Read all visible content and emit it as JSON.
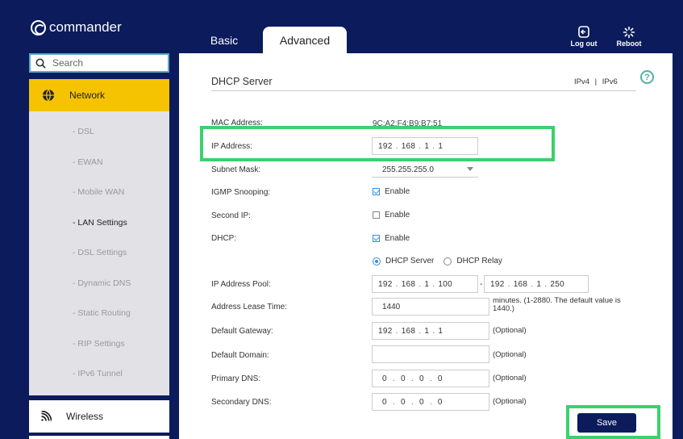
{
  "app": {
    "brand": "commander"
  },
  "tabs": [
    {
      "label": "Basic"
    },
    {
      "label": "Advanced"
    }
  ],
  "topbar": {
    "logout_label": "Log out",
    "reboot_label": "Reboot"
  },
  "search": {
    "placeholder": "Search"
  },
  "sidebar": {
    "section": "Network",
    "items": [
      "- DSL",
      "- EWAN",
      "- Mobile WAN",
      "- LAN Settings",
      "- DSL Settings",
      "- Dynamic DNS",
      "- Static Routing",
      "- RIP Settings",
      "- IPv6 Tunnel"
    ],
    "active_item": "- LAN Settings",
    "next_section": "Wireless"
  },
  "panel": {
    "title": "DHCP Server",
    "ipv4": "IPv4",
    "sep": "|",
    "ipv6": "IPv6",
    "help": "?"
  },
  "fields": {
    "mac_label": "MAC Address:",
    "mac_value": "9C:A2:F4:B9:B7:51",
    "ip_label": "IP Address:",
    "ip_value": [
      "192",
      "168",
      "1",
      "1"
    ],
    "subnet_label": "Subnet Mask:",
    "subnet_value": "255.255.255.0",
    "igmp_label": "IGMP Snooping:",
    "igmp_text": "Enable",
    "second_ip_label": "Second IP:",
    "second_ip_text": "Enable",
    "dhcp_label": "DHCP:",
    "dhcp_text": "Enable",
    "dhcp_mode_server": "DHCP Server",
    "dhcp_mode_relay": "DHCP Relay",
    "pool_label": "IP Address Pool:",
    "pool_start": [
      "192",
      "168",
      "1",
      "100"
    ],
    "pool_dash": "-",
    "pool_end": [
      "192",
      "168",
      "1",
      "250"
    ],
    "lease_label": "Address Lease Time:",
    "lease_value": "1440",
    "lease_hint": "minutes. (1-2880. The default value is 1440.)",
    "gateway_label": "Default Gateway:",
    "gateway_value": [
      "192",
      "168",
      "1",
      "1"
    ],
    "domain_label": "Default Domain:",
    "domain_value": "",
    "pdns_label": "Primary DNS:",
    "pdns_value": [
      "0",
      "0",
      "0",
      "0"
    ],
    "sdns_label": "Secondary DNS:",
    "sdns_value": [
      "0",
      "0",
      "0",
      "0"
    ],
    "optional": "(Optional)",
    "dot": "."
  },
  "actions": {
    "save_label": "Save"
  },
  "colors": {
    "navy": "#0b1b5c",
    "accent": "#f5c301",
    "highlight": "#3bd16c",
    "check": "#3a8bd8"
  }
}
